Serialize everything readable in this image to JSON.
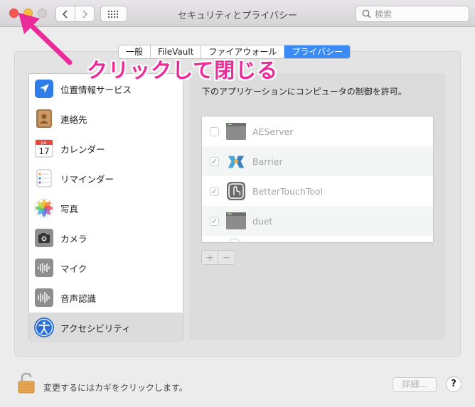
{
  "window": {
    "title": "セキュリティとプライバシー"
  },
  "search": {
    "placeholder": "検索"
  },
  "tabs": [
    {
      "label": "一般",
      "active": false
    },
    {
      "label": "FileVault",
      "active": false
    },
    {
      "label": "ファイアウォール",
      "active": false
    },
    {
      "label": "プライバシー",
      "active": true
    }
  ],
  "annotation": {
    "text": "クリックして閉じる",
    "color": "#ec2b9a"
  },
  "sidebar": {
    "items": [
      {
        "label": "位置情報サービス",
        "icon": "location-icon"
      },
      {
        "label": "連絡先",
        "icon": "contacts-icon"
      },
      {
        "label": "カレンダー",
        "icon": "calendar-icon",
        "icon_month": "JUL",
        "icon_day": "17"
      },
      {
        "label": "リマインダー",
        "icon": "reminders-icon"
      },
      {
        "label": "写真",
        "icon": "photos-icon"
      },
      {
        "label": "カメラ",
        "icon": "camera-icon"
      },
      {
        "label": "マイク",
        "icon": "microphone-icon"
      },
      {
        "label": "音声認識",
        "icon": "speech-recognition-icon"
      },
      {
        "label": "アクセシビリティ",
        "icon": "accessibility-icon",
        "selected": true
      }
    ]
  },
  "main": {
    "prompt": "下のアプリケーションにコンピュータの制御を許可。",
    "apps": [
      {
        "name": "AEServer",
        "checked": false,
        "icon": "app-generic-icon"
      },
      {
        "name": "Barrier",
        "checked": true,
        "icon": "barrier-icon"
      },
      {
        "name": "BetterTouchTool",
        "checked": true,
        "icon": "bettertouchtool-icon"
      },
      {
        "name": "duet",
        "checked": true,
        "icon": "app-generic-icon"
      }
    ],
    "add_label": "+",
    "remove_label": "−"
  },
  "footer": {
    "lock_text": "変更するにはカギをクリックします。",
    "details_label": "詳細...",
    "help_label": "?"
  },
  "colors": {
    "accent": "#3a8bf5",
    "close": "#fc5753",
    "minimize": "#fdbc40",
    "annotation": "#ec2b9a"
  }
}
